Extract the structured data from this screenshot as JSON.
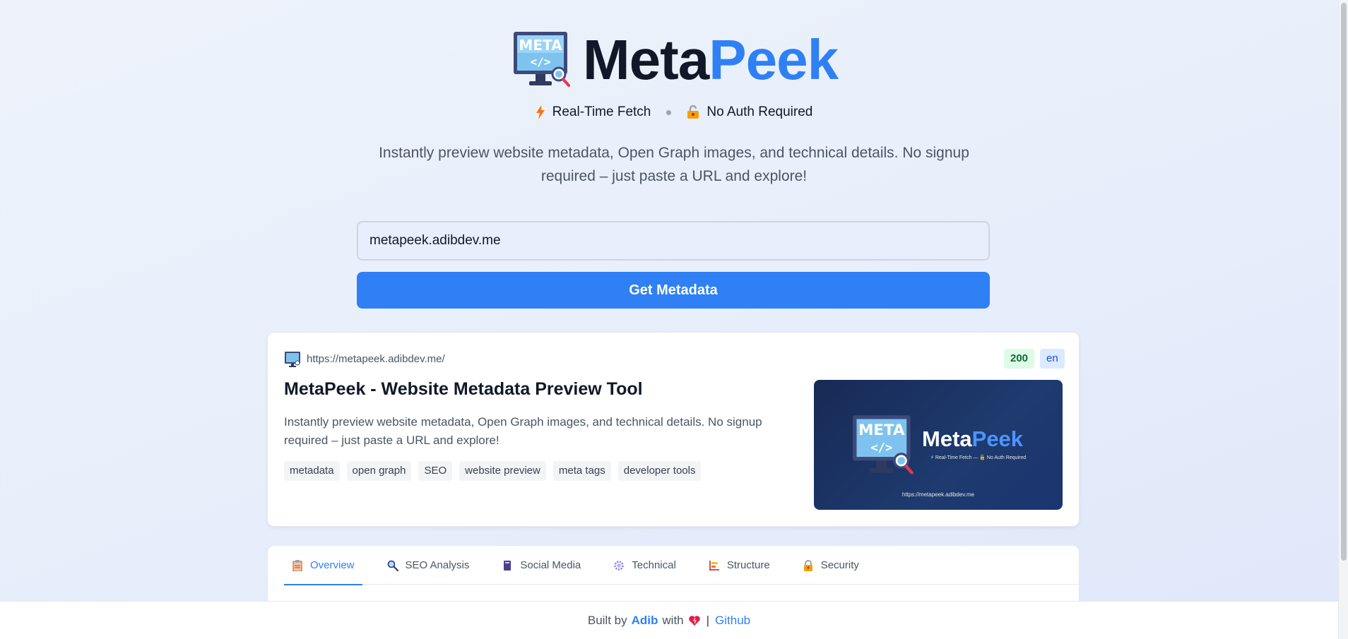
{
  "hero": {
    "brand_meta": "Meta",
    "brand_peek": "Peek",
    "features": [
      {
        "icon": "lightning-icon",
        "label": "Real-Time Fetch"
      },
      {
        "icon": "unlock-icon",
        "label": "No Auth Required"
      }
    ],
    "tagline": "Instantly preview website metadata, Open Graph images, and technical details. No signup required – just paste a URL and explore!"
  },
  "form": {
    "url_value": "metapeek.adibdev.me",
    "submit_label": "Get Metadata"
  },
  "result": {
    "url": "https://metapeek.adibdev.me/",
    "status": "200",
    "lang": "en",
    "title": "MetaPeek - Website Metadata Preview Tool",
    "description": "Instantly preview website metadata, Open Graph images, and technical details. No signup required – just paste a URL and explore!",
    "keywords": [
      "metadata",
      "open graph",
      "SEO",
      "website preview",
      "meta tags",
      "developer tools"
    ],
    "og_image": {
      "brand_meta": "Meta",
      "brand_peek": "Peek",
      "subtitle": "⚡ Real-Time Fetch — 🔓 No Auth Required",
      "url": "https://metapeek.adibdev.me"
    }
  },
  "tabs": [
    {
      "label": "Overview",
      "icon": "clipboard-icon",
      "active": true
    },
    {
      "label": "SEO Analysis",
      "icon": "magnifier-icon",
      "active": false
    },
    {
      "label": "Social Media",
      "icon": "book-icon",
      "active": false
    },
    {
      "label": "Technical",
      "icon": "gear-icon",
      "active": false
    },
    {
      "label": "Structure",
      "icon": "chart-icon",
      "active": false
    },
    {
      "label": "Security",
      "icon": "lock-icon",
      "active": false
    }
  ],
  "footer": {
    "built_by": "Built by",
    "author": "Adib",
    "with": "with",
    "sep": "|",
    "github": "Github"
  },
  "colors": {
    "accent": "#2f80f5",
    "text": "#111827",
    "muted": "#4b5563"
  }
}
